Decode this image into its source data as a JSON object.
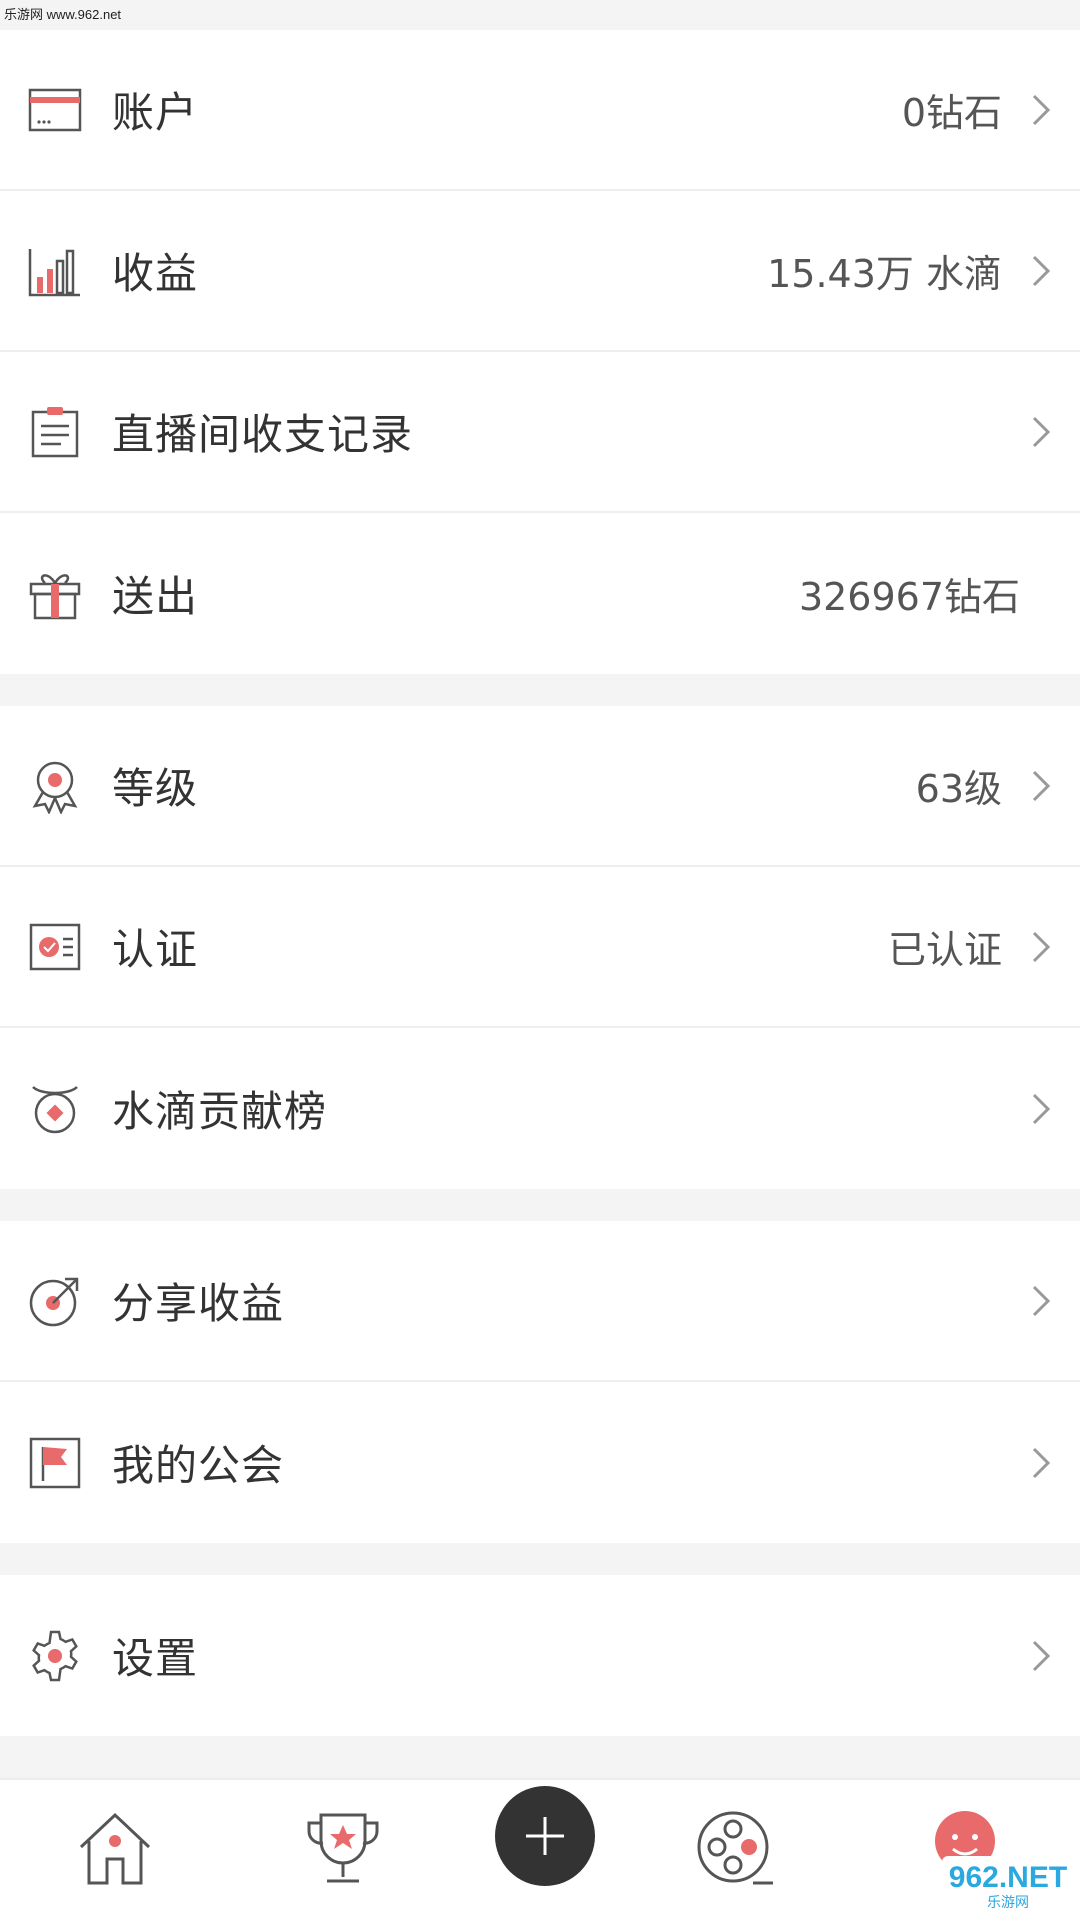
{
  "watermark": {
    "top": "乐游网 www.962.net",
    "bottom_main": "962.NET",
    "bottom_sub": "乐游网"
  },
  "colors": {
    "accent": "#e86a6a",
    "icon_line": "#555555",
    "label": "#333333",
    "value": "#555555",
    "divider": "#eeeeee",
    "background": "#f4f4f4"
  },
  "groups": [
    {
      "items": [
        {
          "icon": "card-icon",
          "label": "账户",
          "value": "0钻石",
          "arrow": true
        },
        {
          "icon": "bar-chart-icon",
          "label": "收益",
          "value": "15.43万 水滴",
          "arrow": true
        },
        {
          "icon": "clipboard-icon",
          "label": "直播间收支记录",
          "value": "",
          "arrow": true
        },
        {
          "icon": "gift-icon",
          "label": "送出",
          "value": "326967钻石",
          "arrow": false
        }
      ]
    },
    {
      "items": [
        {
          "icon": "medal-icon",
          "label": "等级",
          "value": "63级",
          "arrow": true
        },
        {
          "icon": "certificate-icon",
          "label": "认证",
          "value": "已认证",
          "arrow": true
        },
        {
          "icon": "ranking-icon",
          "label": "水滴贡献榜",
          "value": "",
          "arrow": true
        }
      ]
    },
    {
      "items": [
        {
          "icon": "share-icon",
          "label": "分享收益",
          "value": "",
          "arrow": true
        },
        {
          "icon": "flag-icon",
          "label": "我的公会",
          "value": "",
          "arrow": true
        }
      ]
    },
    {
      "items": [
        {
          "icon": "gear-icon",
          "label": "设置",
          "value": "",
          "arrow": true
        }
      ]
    }
  ],
  "tabbar": {
    "tabs": [
      {
        "icon": "home-icon"
      },
      {
        "icon": "trophy-icon"
      },
      {
        "icon": "plus-icon"
      },
      {
        "icon": "film-reel-icon"
      },
      {
        "icon": "profile-face-icon"
      }
    ]
  }
}
